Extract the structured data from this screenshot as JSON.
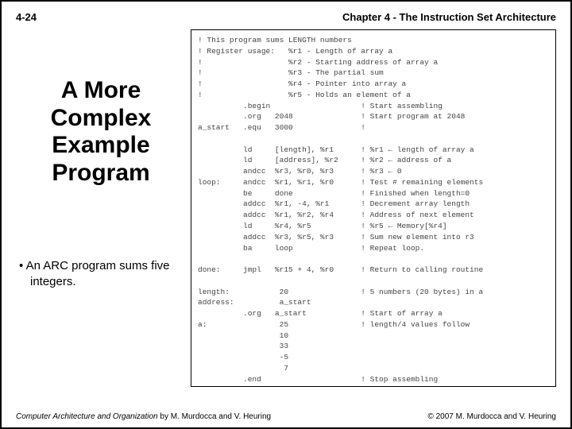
{
  "header": {
    "page_num": "4-24",
    "chapter": "Chapter 4 - The Instruction Set Architecture"
  },
  "title_lines": [
    "A More",
    "Complex",
    "Example",
    "Program"
  ],
  "bullet_text": "An ARC program sums five integers.",
  "code": "! This program sums LENGTH numbers\n! Register usage:   %r1 - Length of array a\n!                   %r2 - Starting address of array a\n!                   %r3 - The partial sum\n!                   %r4 - Pointer into array a\n!                   %r5 - Holds an element of a\n          .begin                    ! Start assembling\n          .org   2048               ! Start program at 2048\na_start   .equ   3000               !\n\n          ld     [length], %r1      ! %r1 ← length of array a\n          ld     [address], %r2     ! %r2 ← address of a\n          andcc  %r3, %r0, %r3      ! %r3 ← 0\nloop:     andcc  %r1, %r1, %r0      ! Test # remaining elements\n          be     done               ! Finished when length=0\n          addcc  %r1, -4, %r1       ! Decrement array length\n          addcc  %r1, %r2, %r4      ! Address of next element\n          ld     %r4, %r5           ! %r5 ← Memory[%r4]\n          addcc  %r3, %r5, %r3      ! Sum new element into r3\n          ba     loop               ! Repeat loop.\n\ndone:     jmpl   %r15 + 4, %r0      ! Return to calling routine\n\nlength:           20                ! 5 numbers (20 bytes) in a\naddress:          a_start\n          .org   a_start            ! Start of array a\na:                25                ! length/4 values follow\n                  10\n                  33\n                  -5\n                   7\n          .end                      ! Stop assembling",
  "footer": {
    "book_title": "Computer Architecture and Organization",
    "authors": " by M. Murdocca and V. Heuring",
    "copyright": "© 2007 M. Murdocca and V. Heuring"
  }
}
